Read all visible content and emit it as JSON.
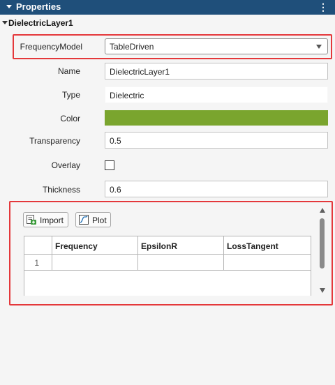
{
  "header": {
    "title": "Properties",
    "menu_glyph": "⋮"
  },
  "section": {
    "title": "DielectricLayer1"
  },
  "properties": {
    "frequency_model": {
      "label": "FrequencyModel",
      "value": "TableDriven"
    },
    "name": {
      "label": "Name",
      "value": "DielectricLayer1"
    },
    "type": {
      "label": "Type",
      "value": "Dielectric"
    },
    "color": {
      "label": "Color",
      "value": "#7aa52e"
    },
    "transparency": {
      "label": "Transparency",
      "value": "0.5"
    },
    "overlay": {
      "label": "Overlay",
      "checked": false
    },
    "thickness": {
      "label": "Thickness",
      "value": "0.6"
    }
  },
  "table_panel": {
    "import_label": "Import",
    "plot_label": "Plot",
    "columns": [
      "Frequency",
      "EpsilonR",
      "LossTangent"
    ],
    "rows": [
      {
        "index": "1",
        "cells": [
          "",
          "",
          ""
        ]
      }
    ]
  },
  "colors": {
    "header_bg": "#1f4f7a",
    "highlight": "#e4383b",
    "layer_color": "#7aa52e"
  }
}
